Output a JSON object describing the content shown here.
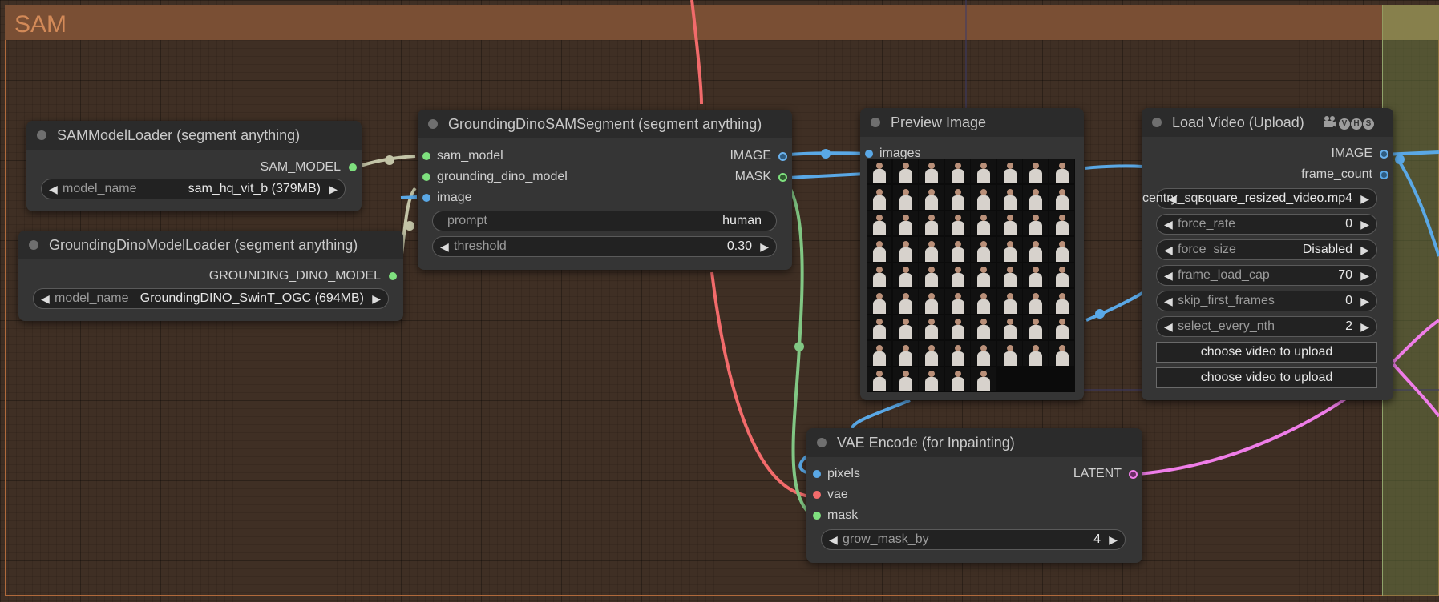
{
  "group": {
    "title": "SAM"
  },
  "colors": {
    "clip_wire": "#c3c4a7",
    "image_wire": "#5aa8e6",
    "mask_wire": "#81c784",
    "vae_wire": "#f26b6b",
    "latent_wire": "#ef7de8"
  },
  "nodes": {
    "sam_loader": {
      "title": "SAMModelLoader (segment anything)",
      "output": "SAM_MODEL",
      "widget": {
        "label": "model_name",
        "value": "sam_hq_vit_b (379MB)"
      }
    },
    "dino_loader": {
      "title": "GroundingDinoModelLoader (segment anything)",
      "output": "GROUNDING_DINO_MODEL",
      "widget": {
        "label": "model_name",
        "value": "GroundingDINO_SwinT_OGC (694MB)"
      }
    },
    "segment": {
      "title": "GroundingDinoSAMSegment (segment anything)",
      "inputs": [
        "sam_model",
        "grounding_dino_model",
        "image"
      ],
      "outputs": [
        "IMAGE",
        "MASK"
      ],
      "prompt": {
        "label": "prompt",
        "value": "human"
      },
      "threshold": {
        "label": "threshold",
        "value": "0.30"
      }
    },
    "preview": {
      "title": "Preview Image",
      "input": "images"
    },
    "load_video": {
      "title": "Load Video (Upload)",
      "badges": [
        "V",
        "H",
        "S"
      ],
      "outputs": [
        "IMAGE",
        "frame_count"
      ],
      "widgets": [
        {
          "label": "centry_sqr",
          "value": "square_resized_video.mp4"
        },
        {
          "label": "force_rate",
          "value": "0"
        },
        {
          "label": "force_size",
          "value": "Disabled"
        },
        {
          "label": "frame_load_cap",
          "value": "70"
        },
        {
          "label": "skip_first_frames",
          "value": "0"
        },
        {
          "label": "select_every_nth",
          "value": "2"
        }
      ],
      "buttons": [
        "choose video to upload",
        "choose video to upload"
      ]
    },
    "vae_encode": {
      "title": "VAE Encode (for Inpainting)",
      "inputs": [
        "pixels",
        "vae",
        "mask"
      ],
      "output": "LATENT",
      "widget": {
        "label": "grow_mask_by",
        "value": "4"
      }
    }
  }
}
